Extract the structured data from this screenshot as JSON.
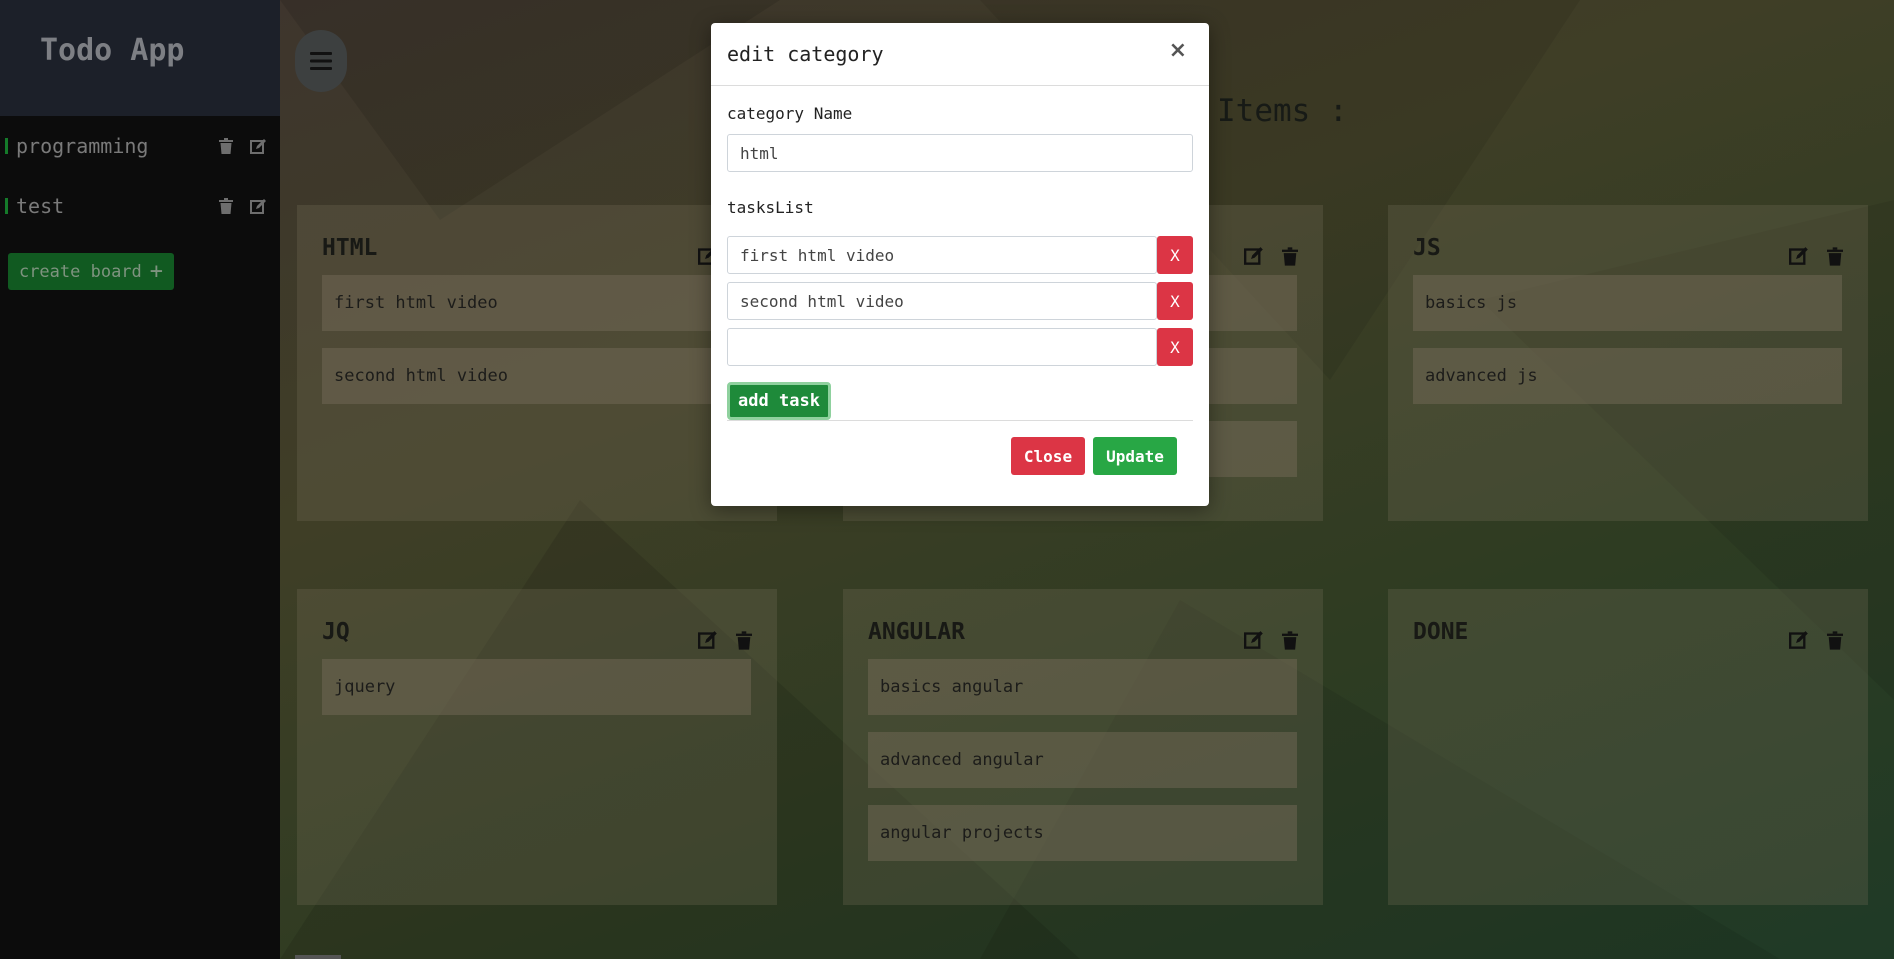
{
  "app": {
    "title": "Todo App"
  },
  "sidebar": {
    "boards": [
      {
        "label": "programming"
      },
      {
        "label": "test"
      }
    ],
    "create_board_label": "create board",
    "create_board_icon": "plus-icon"
  },
  "main": {
    "heading": "Items :",
    "cards": [
      {
        "title": "HTML",
        "tasks": [
          "first html video",
          "second html video"
        ]
      },
      {
        "title": "",
        "tasks": [
          "",
          "",
          ""
        ]
      },
      {
        "title": "JS",
        "tasks": [
          "basics js",
          "advanced js"
        ]
      },
      {
        "title": "JQ",
        "tasks": [
          "jquery"
        ]
      },
      {
        "title": "ANGULAR",
        "tasks": [
          "basics angular",
          "advanced angular",
          "angular projects"
        ]
      },
      {
        "title": "DONE",
        "tasks": []
      }
    ]
  },
  "modal": {
    "title": "edit category",
    "close_symbol": "×",
    "category_name_label": "category Name",
    "category_name_value": "html",
    "tasks_list_label": "tasksList",
    "tasks": [
      "first html video",
      "second html video",
      ""
    ],
    "remove_label": "X",
    "add_task_label": "add task",
    "close_label": "Close",
    "update_label": "Update"
  },
  "colors": {
    "danger": "#dc3545",
    "success": "#28a745",
    "add_task": "#1e8a3a",
    "sidebar_accent": "#157a2a"
  }
}
